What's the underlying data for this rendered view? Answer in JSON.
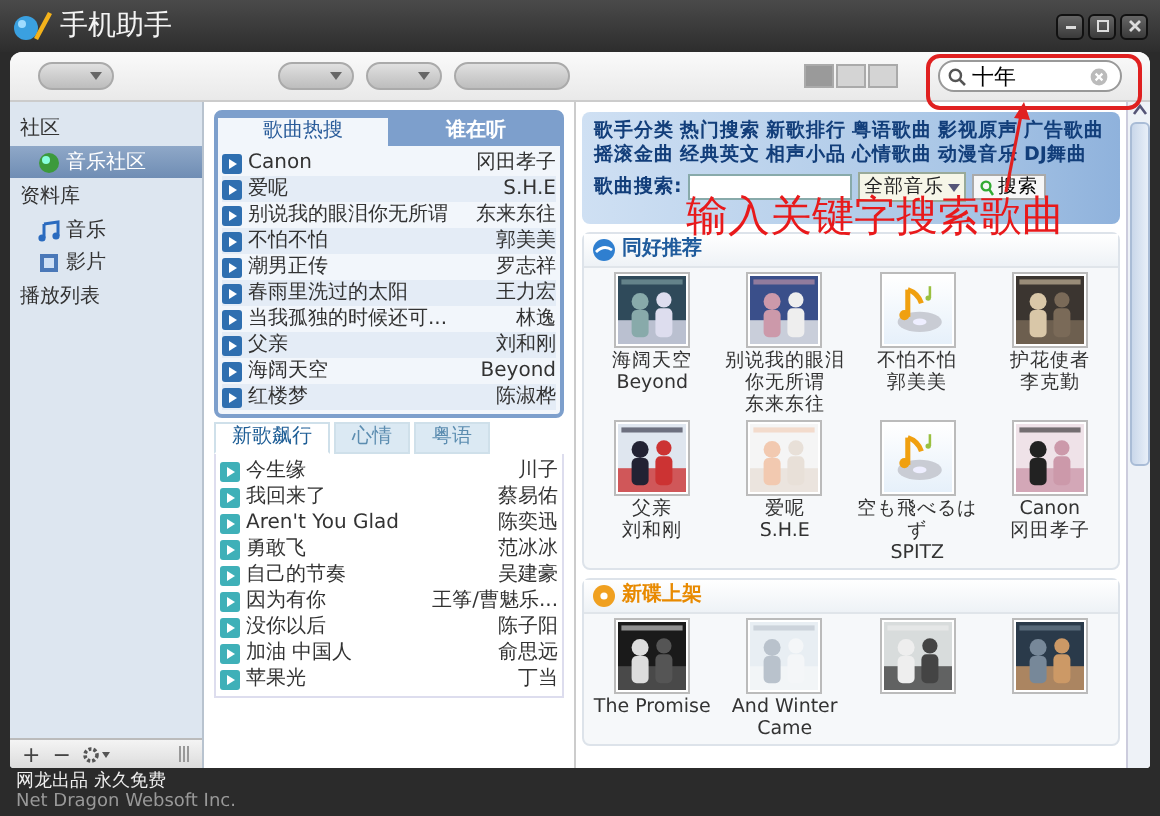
{
  "window": {
    "title": "手机助手"
  },
  "toolbar_buttons": [
    {
      "kind": "menu"
    },
    {
      "kind": "menu"
    },
    {
      "kind": "menu"
    },
    {
      "kind": "plain"
    }
  ],
  "view_modes": [
    {
      "selected": true
    },
    {
      "selected": false
    },
    {
      "selected": false
    }
  ],
  "search": {
    "value": "十年"
  },
  "sidebar": {
    "groups": [
      {
        "label": "社区",
        "items": [
          {
            "label": "音乐社区",
            "selected": true,
            "kind": "community"
          }
        ]
      },
      {
        "label": "资料库",
        "items": [
          {
            "label": "音乐",
            "selected": false,
            "kind": "music"
          },
          {
            "label": "影片",
            "selected": false,
            "kind": "video"
          }
        ]
      },
      {
        "label": "播放列表"
      }
    ],
    "bottom_buttons": [
      "+",
      "−"
    ]
  },
  "hot_panel": {
    "tabs": [
      {
        "label": "歌曲热搜",
        "selected": true
      },
      {
        "label": "谁在听",
        "selected": false
      }
    ],
    "rows": [
      {
        "title": "Canon",
        "artist": "冈田孝子"
      },
      {
        "title": "爱呢",
        "artist": "S.H.E"
      },
      {
        "title": "别说我的眼泪你无所谓",
        "artist": "东来东往"
      },
      {
        "title": "不怕不怕",
        "artist": "郭美美"
      },
      {
        "title": "潮男正传",
        "artist": "罗志祥"
      },
      {
        "title": "春雨里洗过的太阳",
        "artist": "王力宏"
      },
      {
        "title": "当我孤独的时候还可...",
        "artist": "林逸"
      },
      {
        "title": "父亲",
        "artist": "刘和刚"
      },
      {
        "title": "海阔天空",
        "artist": "Beyond"
      },
      {
        "title": "红楼梦",
        "artist": "陈淑桦"
      }
    ]
  },
  "new_panel": {
    "tabs": [
      {
        "label": "新歌飙行",
        "selected": true
      },
      {
        "label": "心情",
        "selected": false
      },
      {
        "label": "粤语",
        "selected": false
      }
    ],
    "rows": [
      {
        "title": "今生缘",
        "artist": "川子"
      },
      {
        "title": "我回来了",
        "artist": "蔡易佑"
      },
      {
        "title": "Aren't You Glad",
        "artist": "陈奕迅"
      },
      {
        "title": "勇敢飞",
        "artist": "范冰冰"
      },
      {
        "title": "自己的节奏",
        "artist": "吴建豪"
      },
      {
        "title": "因为有你",
        "artist": "王筝/曹魅乐..."
      },
      {
        "title": "没你以后",
        "artist": "陈子阳"
      },
      {
        "title": "加油 中国人",
        "artist": "俞思远"
      },
      {
        "title": "苹果光",
        "artist": "丁当"
      }
    ]
  },
  "banner": {
    "link_rows": [
      {
        "links": [
          "歌手分类",
          "热门搜索",
          "新歌排行",
          "粤语歌曲",
          "影视原声",
          "广告歌曲"
        ]
      },
      {
        "links": [
          "摇滚金曲",
          "经典英文",
          "相声小品",
          "心情歌曲",
          "动漫音乐",
          "DJ舞曲"
        ]
      }
    ],
    "search_label": "歌曲搜索:",
    "category": "全部音乐",
    "button": "搜索"
  },
  "sections": [
    {
      "title": "同好推荐",
      "kind": "recommend",
      "albums": [
        {
          "title": "海阔天空",
          "artist": "Beyond",
          "kind": "picture"
        },
        {
          "title": "别说我的眼泪你无所谓",
          "artist": "东来东往",
          "kind": "picture"
        },
        {
          "title": "不怕不怕",
          "artist": "郭美美",
          "kind": "placeholder"
        },
        {
          "title": "护花使者",
          "artist": "李克勤",
          "kind": "picture"
        },
        {
          "title": "父亲",
          "artist": "刘和刚",
          "kind": "picture"
        },
        {
          "title": "爱呢",
          "artist": "S.H.E",
          "kind": "picture"
        },
        {
          "title": "空も飛べるはず",
          "artist": "SPITZ",
          "kind": "placeholder"
        },
        {
          "title": "Canon",
          "artist": "冈田孝子",
          "kind": "picture"
        }
      ]
    },
    {
      "title": "新碟上架",
      "kind": "new",
      "albums": [
        {
          "title": "The Promise",
          "kind": "picture"
        },
        {
          "title": "And Winter Came",
          "kind": "picture"
        },
        {
          "kind": "picture"
        },
        {
          "kind": "picture"
        }
      ]
    }
  ],
  "annotation": {
    "text": "输入关键字搜索歌曲"
  },
  "footer": {
    "line1": "网龙出品 永久免费",
    "line2": "Net Dragon Websoft Inc."
  }
}
